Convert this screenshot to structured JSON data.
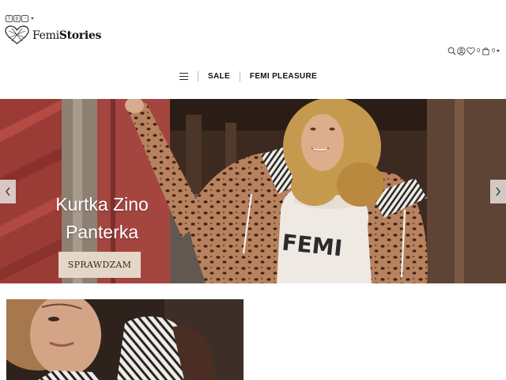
{
  "header": {
    "social_icons": [
      "facebook-icon",
      "pinterest-icon",
      "instagram-icon"
    ],
    "logo": {
      "text_light": "Femi",
      "text_bold": "Stories"
    },
    "tools": {
      "icons": [
        "search-icon",
        "account-icon",
        "wishlist-icon",
        "cart-icon"
      ],
      "wishlist_count": "0",
      "cart_count": "0"
    }
  },
  "nav": {
    "items": [
      {
        "label": "SALE"
      },
      {
        "label": "FEMI PLEASURE"
      }
    ]
  },
  "hero": {
    "caption_line1": "Kurtka Zino",
    "caption_line2": "Panterka",
    "cta_label": "SPRAWDZAM"
  },
  "colors": {
    "cta_background": "#e5d6c8",
    "cta_text": "#3a2a22",
    "text": "#111111"
  }
}
